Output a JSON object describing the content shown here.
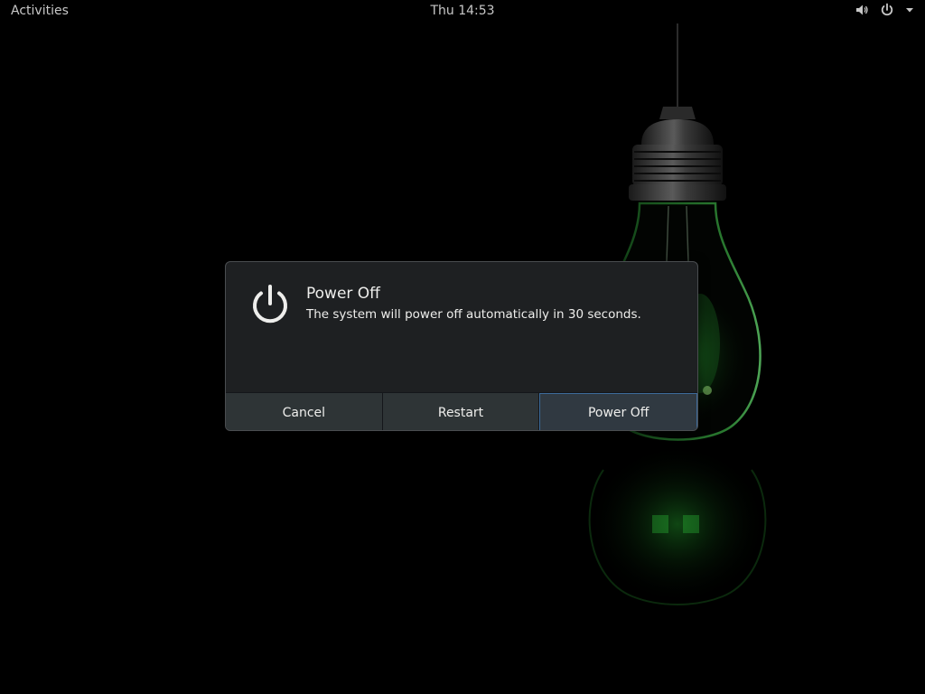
{
  "topbar": {
    "activities_label": "Activities",
    "clock": "Thu 14:53",
    "tray_icons": [
      "volume-icon",
      "power-icon",
      "chevron-down-icon"
    ]
  },
  "dialog": {
    "icon": "power-icon",
    "title": "Power Off",
    "message": "The system will power off automatically in 30 seconds.",
    "buttons": {
      "cancel": "Cancel",
      "restart": "Restart",
      "power_off": "Power Off"
    }
  },
  "wallpaper": {
    "theme": "light-bulb",
    "glow_color": "#1f9a2a",
    "background_color": "#000000"
  }
}
